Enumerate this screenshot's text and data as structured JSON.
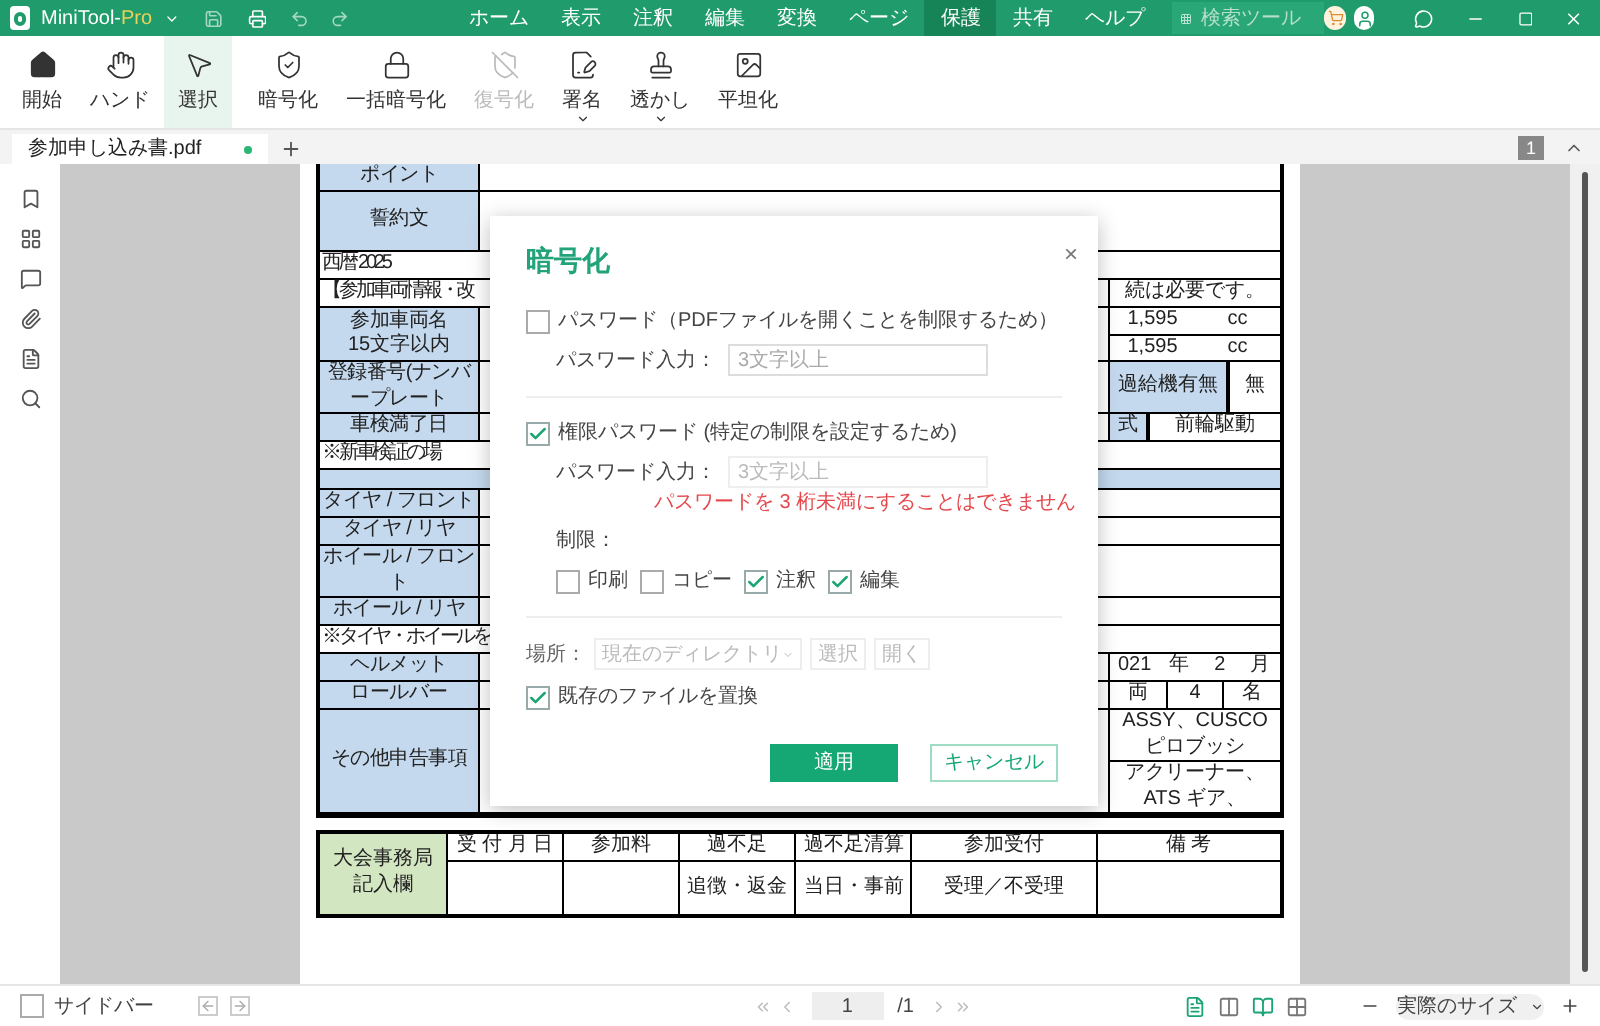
{
  "app": {
    "name": "MiniTool-",
    "edition": "Pro"
  },
  "menu": [
    {
      "label": "ホーム",
      "selected": false
    },
    {
      "label": "表示",
      "selected": false
    },
    {
      "label": "注釈",
      "selected": false
    },
    {
      "label": "編集",
      "selected": false
    },
    {
      "label": "変換",
      "selected": false
    },
    {
      "label": "ページ",
      "selected": false
    },
    {
      "label": "保護",
      "selected": true
    },
    {
      "label": "共有",
      "selected": false
    },
    {
      "label": "ヘルプ",
      "selected": false
    }
  ],
  "search": {
    "placeholder": "検索ツール"
  },
  "ribbon": [
    {
      "label": "開始",
      "selected": false,
      "disabled": false,
      "dropdown": false
    },
    {
      "label": "ハンド",
      "selected": false,
      "disabled": false,
      "dropdown": false
    },
    {
      "label": "選択",
      "selected": true,
      "disabled": false,
      "dropdown": false
    },
    {
      "label": "暗号化",
      "selected": false,
      "disabled": false,
      "dropdown": false
    },
    {
      "label": "一括暗号化",
      "selected": false,
      "disabled": false,
      "dropdown": false
    },
    {
      "label": "復号化",
      "selected": false,
      "disabled": true,
      "dropdown": false
    },
    {
      "label": "署名",
      "selected": false,
      "disabled": false,
      "dropdown": true
    },
    {
      "label": "透かし",
      "selected": false,
      "disabled": false,
      "dropdown": true
    },
    {
      "label": "平坦化",
      "selected": false,
      "disabled": false,
      "dropdown": false
    }
  ],
  "tabs": [
    {
      "label": "参加申し込み書.pdf",
      "selected": true,
      "modified": true
    }
  ],
  "page_badge": "1",
  "document": {
    "rows": [
      {
        "kind": "label",
        "label": "ポイント"
      },
      {
        "kind": "tall",
        "label": "誓約文"
      },
      {
        "kind": "note",
        "label": "西暦 2025"
      },
      {
        "kind": "note",
        "label": "【参加車両情報・改",
        "right": [
          [
            {
              "text": "続は必要です。",
              "kind": "text"
            }
          ]
        ]
      },
      {
        "kind": "label",
        "label": "参加車両名",
        "sublabel": "15文字以内",
        "right": [
          [
            {
              "text": "1,595",
              "kind": "text"
            },
            {
              "text": "cc",
              "kind": "text"
            }
          ],
          [
            {
              "text": "1,595",
              "kind": "text"
            },
            {
              "text": "cc",
              "kind": "text"
            }
          ]
        ]
      },
      {
        "kind": "label",
        "label": "登録番号(ナンバープレート",
        "right": [
          [
            {
              "text": "過給機有無",
              "kind": "head"
            },
            {
              "text": "無",
              "kind": "value"
            }
          ]
        ]
      },
      {
        "kind": "label",
        "label": "車検満了日",
        "right": [
          [
            {
              "text": "式",
              "kind": "head"
            },
            {
              "text": "前輪駆動",
              "kind": "value"
            }
          ]
        ]
      },
      {
        "kind": "note",
        "label": "※新車検証の場"
      },
      {
        "kind": "band"
      },
      {
        "kind": "label",
        "label": "タイヤ / フロント"
      },
      {
        "kind": "label",
        "label": "タイヤ / リヤ"
      },
      {
        "kind": "label",
        "label": "ホイール / フロント"
      },
      {
        "kind": "label",
        "label": "ホイール / リヤ"
      },
      {
        "kind": "note",
        "label": "※タイヤ・ホイールを"
      },
      {
        "kind": "label",
        "label": "ヘルメット",
        "right": [
          [
            {
              "text": "021",
              "kind": "text"
            },
            {
              "text": "年",
              "kind": "text"
            },
            {
              "text": "2",
              "kind": "text"
            },
            {
              "text": "月",
              "kind": "text"
            }
          ]
        ]
      },
      {
        "kind": "label",
        "label": "ロールバー",
        "right": [
          [
            {
              "text": "両",
              "kind": "text"
            },
            {
              "text": "4",
              "kind": "value"
            },
            {
              "text": "名",
              "kind": "value"
            }
          ]
        ]
      },
      {
        "kind": "tall",
        "label": "その他申告事項",
        "right": [
          [
            {
              "text": "ASSY、CUSCOピロブッシ",
              "kind": "text"
            }
          ],
          [
            {
              "text": "アクリーナー、ATS ギア、",
              "kind": "text"
            }
          ]
        ]
      }
    ],
    "office": {
      "title": [
        "大会事務局",
        "記入欄"
      ],
      "columns": [
        {
          "header": "受 付 月 日"
        },
        {
          "header": "参加料"
        },
        {
          "header": "過不足",
          "value": "追徴・返金"
        },
        {
          "header": "過不足清算",
          "value": "当日・事前"
        },
        {
          "header": "参加受付",
          "value": "受理／不受理"
        },
        {
          "header": "備 考"
        }
      ]
    }
  },
  "dialog": {
    "title": "暗号化",
    "close": "×",
    "open_password": {
      "label": "パスワード（PDFファイルを開くことを制限するため）",
      "checked": false,
      "field_label": "パスワード入力：",
      "placeholder": "3文字以上"
    },
    "permission_password": {
      "label": "権限パスワード (特定の制限を設定するため)",
      "checked": true,
      "field_label": "パスワード入力：",
      "placeholder": "3文字以上",
      "error": "パスワードを 3 桁未満にすることはできません",
      "restrictions_label": "制限：",
      "restrictions": [
        {
          "label": "印刷",
          "checked": false
        },
        {
          "label": "コピー",
          "checked": false
        },
        {
          "label": "注釈",
          "checked": true
        },
        {
          "label": "編集",
          "checked": true
        }
      ]
    },
    "location": {
      "label": "場所：",
      "value": "現在のディレクトリ",
      "buttons": [
        "選択",
        "開く"
      ],
      "disabled": true
    },
    "replace": {
      "label": "既存のファイルを置換",
      "checked": true
    },
    "buttons": [
      {
        "label": "適用",
        "kind": "primary"
      },
      {
        "label": "キャンセル",
        "kind": "secondary"
      }
    ]
  },
  "status": {
    "sidebar": {
      "label": "サイドバー",
      "checked": false
    },
    "page": "1",
    "total": "/1",
    "views": [
      {
        "selected": true
      },
      {
        "selected": false
      },
      {
        "selected": true
      },
      {
        "selected": false
      }
    ],
    "zoom": "実際のサイズ"
  }
}
